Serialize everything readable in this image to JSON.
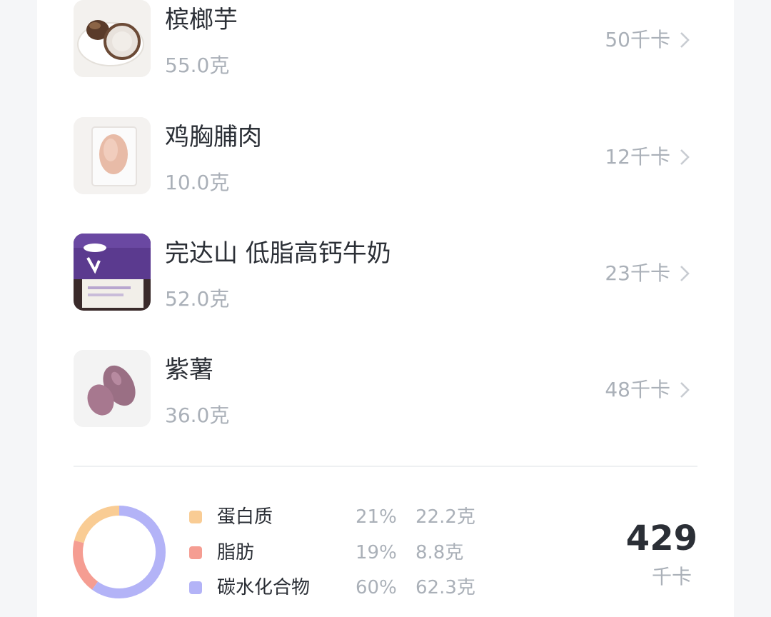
{
  "foods": [
    {
      "name": "槟榔芋",
      "weight": "55.0克",
      "kcal": "50千卡",
      "image": "taro-photo"
    },
    {
      "name": "鸡胸脯肉",
      "weight": "10.0克",
      "kcal": "12千卡",
      "image": "chicken-breast-photo"
    },
    {
      "name": "完达山 低脂高钙牛奶",
      "weight": "52.0克",
      "kcal": "23千卡",
      "image": "milk-carton-photo"
    },
    {
      "name": "紫薯",
      "weight": "36.0克",
      "kcal": "48千卡",
      "image": "purple-sweet-potato-photo"
    }
  ],
  "nutrition": {
    "items": [
      {
        "name": "蛋白质",
        "percent": "21%",
        "grams": "22.2克",
        "fraction": 0.21,
        "color": "#f9cc94"
      },
      {
        "name": "脂肪",
        "percent": "19%",
        "grams": "8.8克",
        "fraction": 0.19,
        "color": "#f59d92"
      },
      {
        "name": "碳水化合物",
        "percent": "60%",
        "grams": "62.3克",
        "fraction": 0.6,
        "color": "#b3b3f7"
      }
    ],
    "total_value": "429",
    "total_unit": "千卡"
  },
  "colors": {
    "title_text": "#2b2f36",
    "secondary_text": "#aab0b8",
    "divider": "#eef0f2"
  },
  "icons": {
    "row_arrow": "chevron-right-icon"
  }
}
